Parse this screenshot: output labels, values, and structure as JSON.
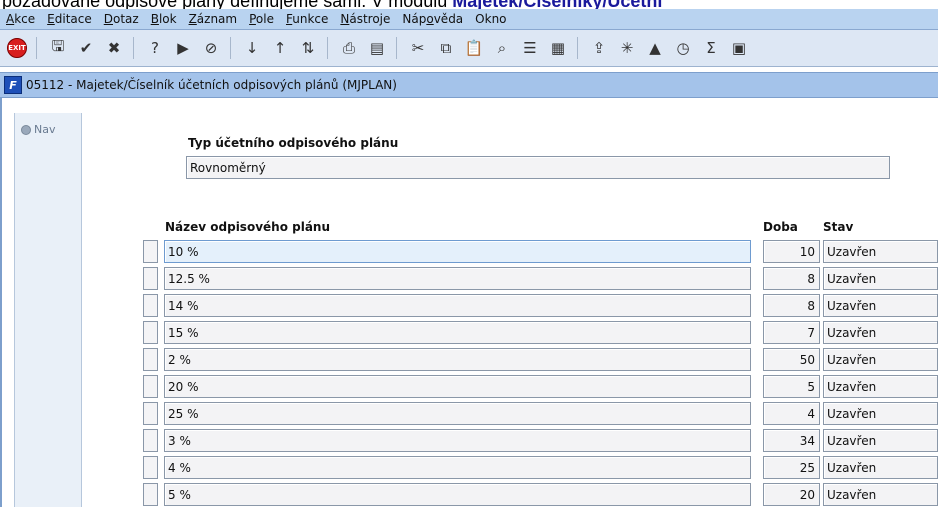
{
  "doc_fragment": {
    "text": "požadované odpisové plány definujeme sami. V modulu ",
    "bold": "Majetek/Číselníky/Účetní"
  },
  "menu": [
    {
      "pre": "",
      "key": "A",
      "post": "kce"
    },
    {
      "pre": "",
      "key": "E",
      "post": "ditace"
    },
    {
      "pre": "",
      "key": "D",
      "post": "otaz"
    },
    {
      "pre": "",
      "key": "B",
      "post": "lok"
    },
    {
      "pre": "",
      "key": "Z",
      "post": "áznam"
    },
    {
      "pre": "",
      "key": "P",
      "post": "ole"
    },
    {
      "pre": "",
      "key": "F",
      "post": "unkce"
    },
    {
      "pre": "",
      "key": "N",
      "post": "ástroje"
    },
    {
      "pre": "Náp",
      "key": "o",
      "post": "věda"
    },
    {
      "pre": "Okno",
      "key": "",
      "post": ""
    }
  ],
  "toolbar": {
    "exit_label": "EXIT",
    "icons": [
      "exit-icon",
      "sep",
      "save-icon",
      "commit-icon",
      "delete-record-icon",
      "sep",
      "query-icon",
      "query-run-icon",
      "query-cancel-icon",
      "sep",
      "sort-asc-icon",
      "sort-desc-icon",
      "sort-multi-icon",
      "sep",
      "print-icon",
      "print-preview-icon",
      "sep",
      "cut-icon",
      "copy-icon",
      "paste-icon",
      "find-icon",
      "filter-icon",
      "grid-icon",
      "sep",
      "export-icon",
      "chart-icon",
      "alert-icon",
      "clock-icon",
      "sum-icon",
      "excel-icon"
    ]
  },
  "window": {
    "app_icon": "F",
    "title": "05112 - Majetek/Číselník účetních odpisových plánů (MJPLAN)"
  },
  "nav": {
    "label": "Nav"
  },
  "form": {
    "type_label": "Typ účetního odpisového plánu",
    "type_value": "Rovnoměrný",
    "columns": {
      "name": "Název odpisového plánu",
      "duration": "Doba",
      "status": "Stav"
    },
    "rows": [
      {
        "name": "10 %",
        "duration": "10",
        "status": "Uzavřen"
      },
      {
        "name": "12.5 %",
        "duration": "8",
        "status": "Uzavřen"
      },
      {
        "name": "14 %",
        "duration": "8",
        "status": "Uzavřen"
      },
      {
        "name": "15 %",
        "duration": "7",
        "status": "Uzavřen"
      },
      {
        "name": "2 %",
        "duration": "50",
        "status": "Uzavřen"
      },
      {
        "name": "20 %",
        "duration": "5",
        "status": "Uzavřen"
      },
      {
        "name": "25 %",
        "duration": "4",
        "status": "Uzavřen"
      },
      {
        "name": "3 %",
        "duration": "34",
        "status": "Uzavřen"
      },
      {
        "name": "4 %",
        "duration": "25",
        "status": "Uzavřen"
      },
      {
        "name": "5 %",
        "duration": "20",
        "status": "Uzavřen"
      }
    ]
  },
  "colors": {
    "menu_bg": "#b9d3f0",
    "title_bg": "#a4c3ea",
    "active_field": "#e4f0fb"
  }
}
